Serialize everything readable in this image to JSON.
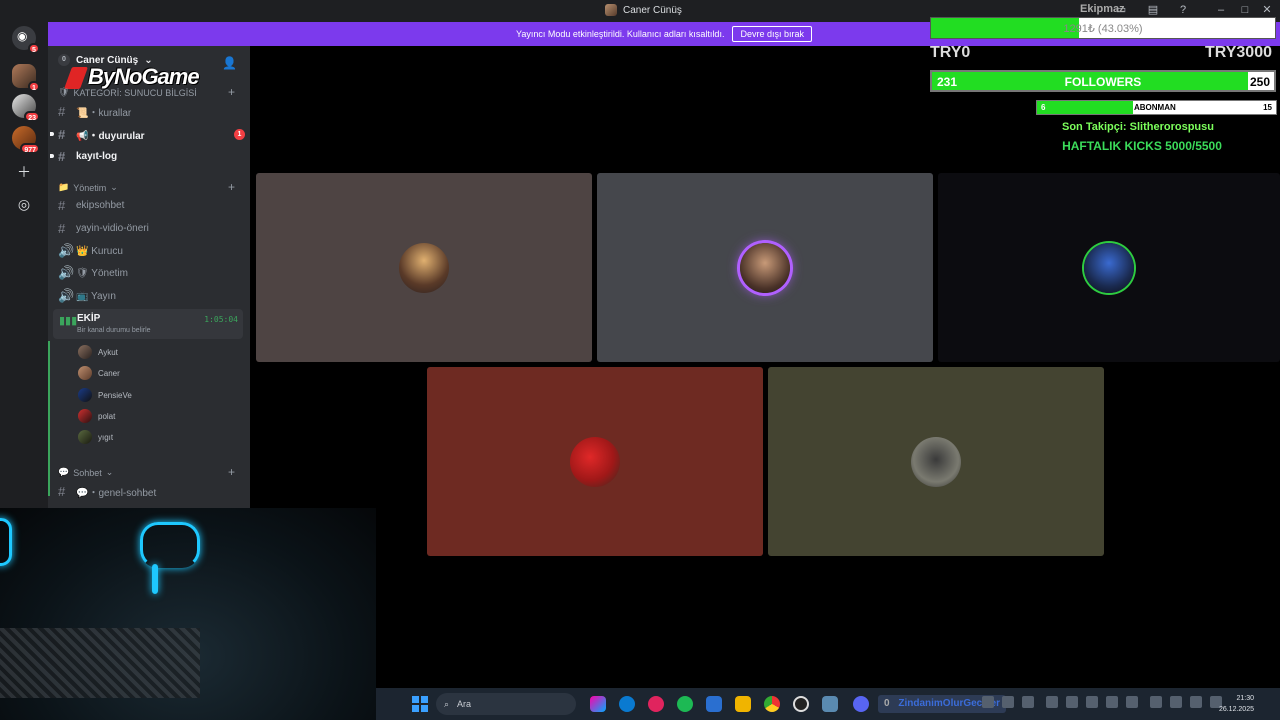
{
  "window": {
    "title": "Caner Cünüş",
    "controls": [
      "minimize-icon",
      "maximize-icon",
      "close-icon"
    ]
  },
  "banner": {
    "text": "Yayıncı Modu etkinleştirildi. Kullanıcı adları kısaltıldı.",
    "button": "Devre dışı bırak"
  },
  "rail": {
    "servers": [
      {
        "badge": "5"
      },
      {
        "badge": "1"
      },
      {
        "badge": "23"
      },
      {
        "badge": "977"
      }
    ]
  },
  "sidebar": {
    "server_name": "Caner Cünüş",
    "server_badge": "0",
    "brand": "ByNoGame",
    "categories": [
      {
        "label": "KATEGORİ: SUNUCU BİLGİSİ"
      },
      {
        "label": "Yönetim"
      },
      {
        "label": "Sohbet"
      }
    ],
    "channels": {
      "kurallar": "📜・kurallar",
      "duyurular": "📢・duyurular",
      "duyurular_badge": "1",
      "kayit_log": "kayıt-log",
      "ekipsohbet": "ekipsohbet",
      "yayin_vidio": "yayin-vidio-öneri",
      "kurucu": "👑 Kurucu",
      "yonetim": "🛡 Yönetim",
      "yayin": "📺 Yayın",
      "genel_sohbet": "💬・genel-sohbet"
    },
    "voice": {
      "name": "EKİP",
      "status": "Bir kanal durumu belirle",
      "time": "1:05:04",
      "members": [
        "Aykut",
        "Caner",
        "PensieVe",
        "polat",
        "yıgıt"
      ]
    }
  },
  "overlay": {
    "goal_title": "Ekipmaz",
    "goal_text": "1291₺ (43.03%)",
    "goal_fraction": 0.4303,
    "try_left": "TRY0",
    "try_right": "TRY3000",
    "followers_current": "231",
    "followers_label": "FOLLOWERS",
    "followers_goal": "250",
    "followers_fraction": 0.924,
    "abone_current": "6",
    "abone_label": "ABONMAN",
    "abone_goal": "15",
    "abone_fraction": 0.4,
    "last_follower": "Son Takipçi: Slitherorospusu",
    "kicks": "HAFTALIK KICKS 5000/5500"
  },
  "tiles": [
    {
      "color": "#4e4443"
    },
    {
      "color": "#45474c"
    },
    {
      "color": "#0c0c10"
    },
    {
      "color": "#6e2a22"
    },
    {
      "color": "#444431"
    }
  ],
  "taskbar": {
    "search_placeholder": "Ara",
    "status_count": "0",
    "status_text": "ZindanimOlurGeceler",
    "time": "21:30",
    "date": "26.12.2025"
  }
}
